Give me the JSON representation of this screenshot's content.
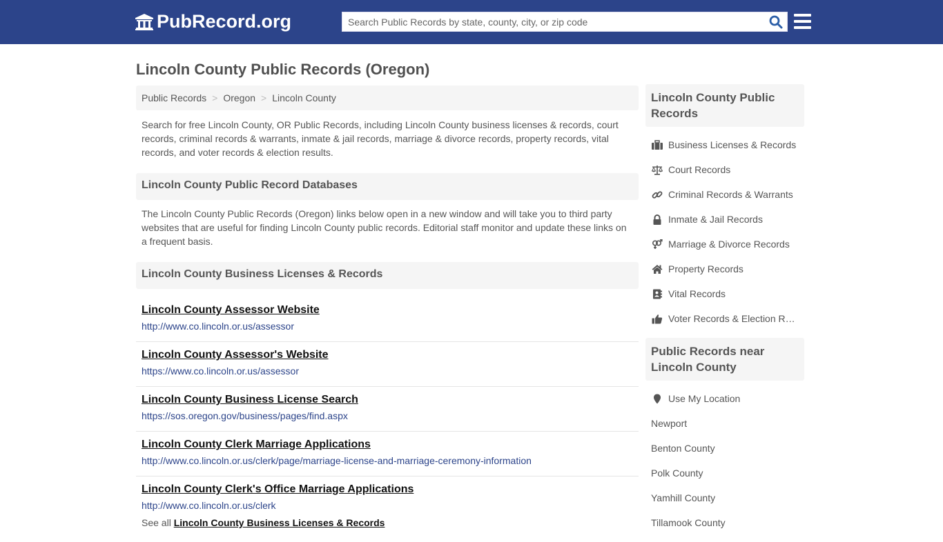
{
  "header": {
    "logo_text": "PubRecord.org",
    "search_placeholder": "Search Public Records by state, county, city, or zip code",
    "search_value": "",
    "brand_color": "#2c448a"
  },
  "page_title": "Lincoln County Public Records (Oregon)",
  "breadcrumb": [
    {
      "label": "Public Records"
    },
    {
      "label": "Oregon"
    },
    {
      "label": "Lincoln County"
    }
  ],
  "intro": "Search for free Lincoln County, OR Public Records, including Lincoln County business licenses & records, court records, criminal records & warrants, inmate & jail records, marriage & divorce records, property records, vital records, and voter records & election results.",
  "databases": {
    "heading": "Lincoln County Public Record Databases",
    "description": "The Lincoln County Public Records (Oregon) links below open in a new window and will take you to third party websites that are useful for finding Lincoln County public records. Editorial staff monitor and update these links on a frequent basis."
  },
  "business_section": {
    "heading": "Lincoln County Business Licenses & Records",
    "links": [
      {
        "title": "Lincoln County Assessor Website",
        "url": "http://www.co.lincoln.or.us/assessor"
      },
      {
        "title": "Lincoln County Assessor's Website",
        "url": "https://www.co.lincoln.or.us/assessor"
      },
      {
        "title": "Lincoln County Business License Search",
        "url": "https://sos.oregon.gov/business/pages/find.aspx"
      },
      {
        "title": "Lincoln County Clerk Marriage Applications",
        "url": "http://www.co.lincoln.or.us/clerk/page/marriage-license-and-marriage-ceremony-information"
      },
      {
        "title": "Lincoln County Clerk's Office Marriage Applications",
        "url": "http://www.co.lincoln.or.us/clerk"
      }
    ],
    "see_all_prefix": "See all",
    "see_all_link": "Lincoln County Business Licenses & Records"
  },
  "sidebar": {
    "records_heading": "Lincoln County Public Records",
    "records": [
      {
        "label": "Business Licenses & Records",
        "icon": "briefcase-icon"
      },
      {
        "label": "Court Records",
        "icon": "balance-scale-icon"
      },
      {
        "label": "Criminal Records & Warrants",
        "icon": "link-icon"
      },
      {
        "label": "Inmate & Jail Records",
        "icon": "lock-icon"
      },
      {
        "label": "Marriage & Divorce Records",
        "icon": "venus-mars-icon"
      },
      {
        "label": "Property Records",
        "icon": "home-icon"
      },
      {
        "label": "Vital Records",
        "icon": "address-book-icon"
      },
      {
        "label": "Voter Records & Election Results",
        "icon": "thumbs-up-icon"
      }
    ],
    "near_heading": "Public Records near Lincoln County",
    "use_location": "Use My Location",
    "near": [
      "Newport",
      "Benton County",
      "Polk County",
      "Yamhill County",
      "Tillamook County"
    ]
  }
}
